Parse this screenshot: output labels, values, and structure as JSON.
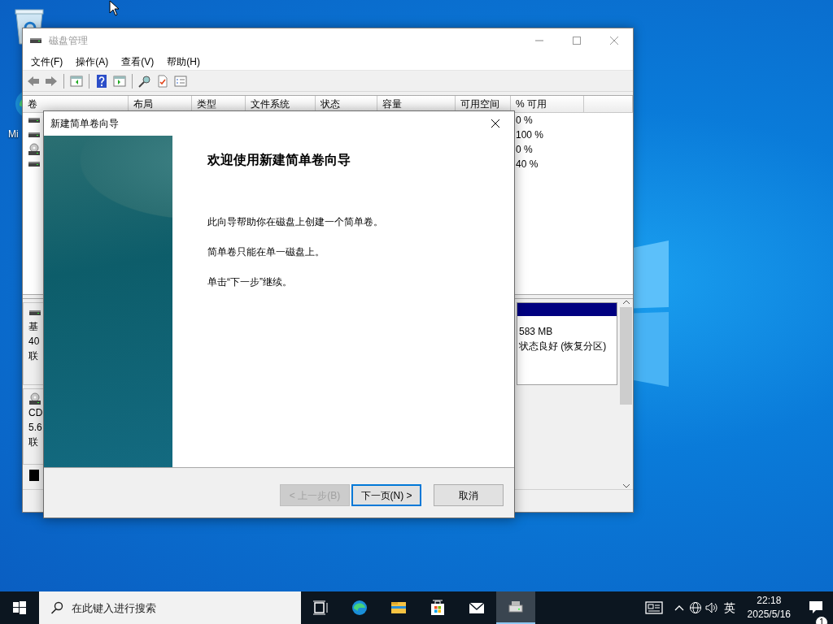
{
  "desktop": {
    "icons": [
      {
        "kind": "recycle-bin"
      },
      {
        "kind": "edge",
        "label": "Mi"
      }
    ]
  },
  "disk_management": {
    "title": "磁盘管理",
    "menu": [
      "文件(F)",
      "操作(A)",
      "查看(V)",
      "帮助(H)"
    ],
    "toolbar": [
      {
        "kind": "back"
      },
      {
        "kind": "forward"
      },
      {
        "kind": "separator"
      },
      {
        "kind": "console-tree"
      },
      {
        "kind": "separator"
      },
      {
        "kind": "help"
      },
      {
        "kind": "action-pane"
      },
      {
        "kind": "separator"
      },
      {
        "kind": "connect"
      },
      {
        "kind": "check-doc"
      },
      {
        "kind": "list"
      }
    ],
    "table": {
      "columns": [
        "卷",
        "布局",
        "类型",
        "文件系统",
        "状态",
        "容量",
        "可用空间",
        "% 可用"
      ],
      "rows": [
        {
          "kind": "disk",
          "percent_free": "0 %"
        },
        {
          "kind": "disk",
          "percent_free": "100 %"
        },
        {
          "kind": "cd",
          "percent_free": "0 %"
        },
        {
          "kind": "disk",
          "percent_free": "40 %"
        }
      ]
    },
    "disks": [
      {
        "kind": "disk",
        "lines": [
          "基",
          "40",
          "联"
        ],
        "partition_lines": [
          "583 MB",
          "状态良好 (恢复分区)"
        ]
      },
      {
        "kind": "cd",
        "lines": [
          "CD",
          "5.6",
          "联"
        ]
      }
    ],
    "legend": [
      {
        "color": "#000000"
      }
    ]
  },
  "wizard": {
    "title": "新建简单卷向导",
    "heading": "欢迎使用新建简单卷向导",
    "paragraphs": [
      "此向导帮助你在磁盘上创建一个简单卷。",
      "简单卷只能在单一磁盘上。",
      "单击“下一步”继续。"
    ],
    "buttons": [
      {
        "label": "< 上一步(B)",
        "disabled": true,
        "default": false
      },
      {
        "label": "下一页(N) >",
        "disabled": false,
        "default": true
      },
      {
        "label": "取消",
        "disabled": false,
        "default": false
      }
    ]
  },
  "taskbar": {
    "search_placeholder": "在此键入进行搜索",
    "apps": [
      {
        "kind": "task-view",
        "active": false
      },
      {
        "kind": "edge",
        "active": false
      },
      {
        "kind": "explorer",
        "active": false
      },
      {
        "kind": "store",
        "active": false
      },
      {
        "kind": "mail",
        "active": false
      },
      {
        "kind": "disk-management",
        "active": true
      }
    ],
    "language": "英",
    "time": "22:18",
    "date": "2025/5/16",
    "notification_count": "1"
  }
}
